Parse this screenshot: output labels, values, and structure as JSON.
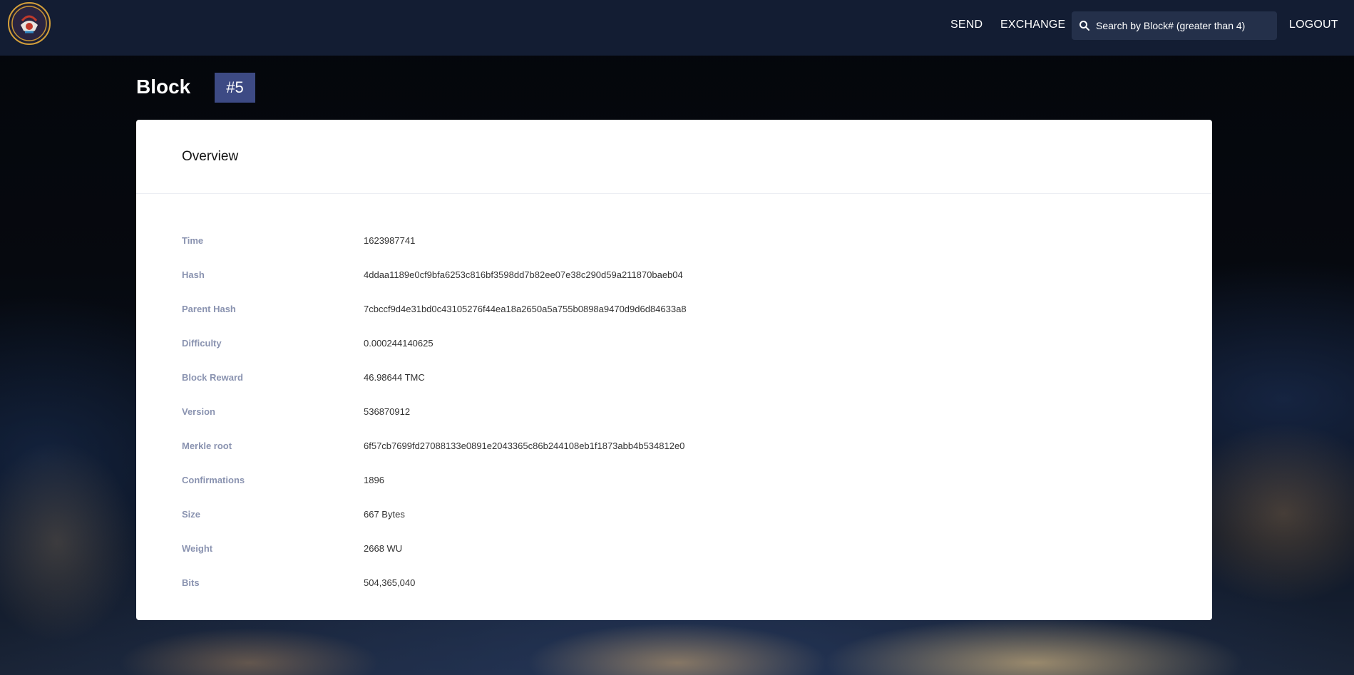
{
  "header": {
    "logo_alt": "logo",
    "nav": {
      "send": "SEND",
      "exchange": "EXCHANGE",
      "logout": "LOGOUT"
    },
    "search": {
      "placeholder": "Search by Block# (greater than 4)"
    }
  },
  "page": {
    "title": "Block",
    "badge": "#5"
  },
  "overview": {
    "title": "Overview",
    "rows": [
      {
        "label": "Time",
        "value": "1623987741"
      },
      {
        "label": "Hash",
        "value": "4ddaa1189e0cf9bfa6253c816bf3598dd7b82ee07e38c290d59a211870baeb04"
      },
      {
        "label": "Parent Hash",
        "value": "7cbccf9d4e31bd0c43105276f44ea18a2650a5a755b0898a9470d9d6d84633a8"
      },
      {
        "label": "Difficulty",
        "value": "0.000244140625"
      },
      {
        "label": "Block Reward",
        "value": "46.98644 TMC"
      },
      {
        "label": "Version",
        "value": "536870912"
      },
      {
        "label": "Merkle root",
        "value": "6f57cb7699fd27088133e0891e2043365c86b244108eb1f1873abb4b534812e0"
      },
      {
        "label": "Confirmations",
        "value": "1896"
      },
      {
        "label": "Size",
        "value": "667 Bytes"
      },
      {
        "label": "Weight",
        "value": "2668 WU"
      },
      {
        "label": "Bits",
        "value": "504,365,040"
      }
    ]
  },
  "colors": {
    "topbar": "#131d33",
    "badge": "#3d4a84",
    "label": "#8a93b0",
    "logo_ring": "#d4a03a"
  },
  "icons": {
    "logo": "emblem-icon",
    "search": "search-icon"
  }
}
